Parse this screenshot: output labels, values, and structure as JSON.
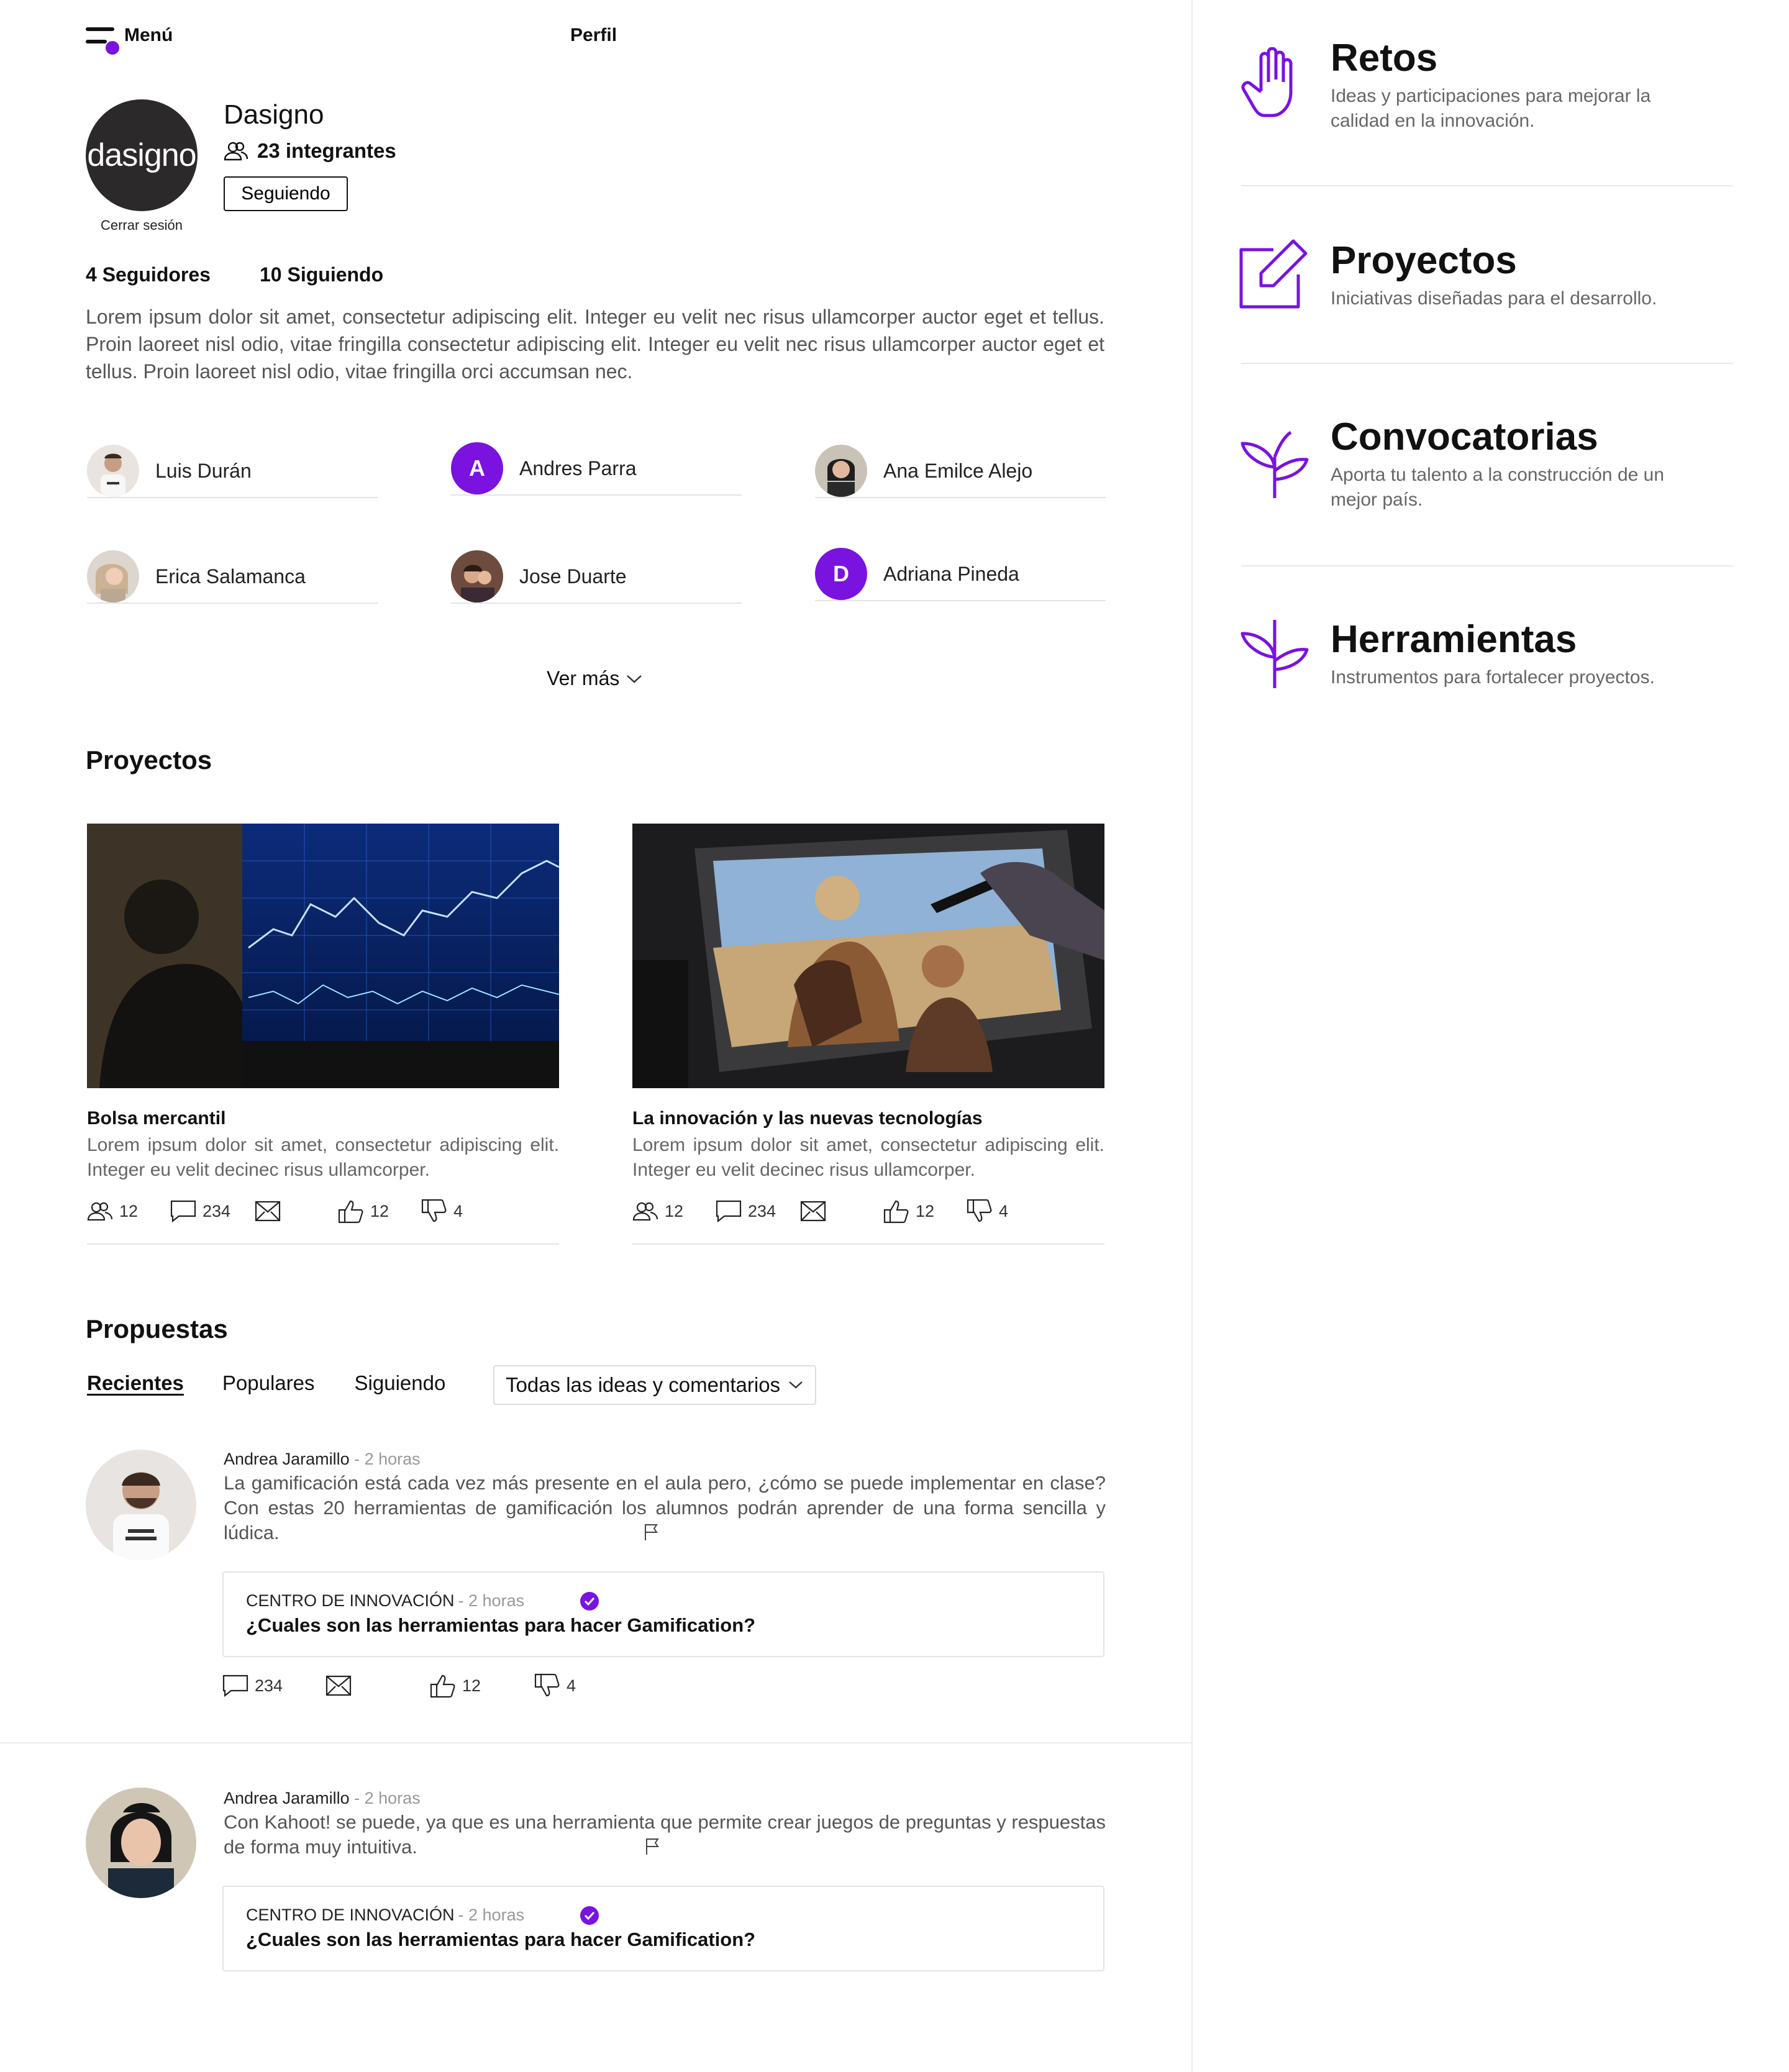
{
  "header": {
    "menu_label": "Menú",
    "page_title": "Perfil"
  },
  "profile": {
    "logo_text": "dasigno",
    "logout_label": "Cerrar sesión",
    "name": "Dasigno",
    "members_label": "23 integrantes",
    "follow_button": "Seguiendo",
    "followers": "4 Seguidores",
    "following": "10 Siguiendo",
    "description": "Lorem ipsum dolor sit amet, consectetur adipiscing elit. Integer eu velit nec risus ullamcorper auctor eget et tellus. Proin laoreet nisl odio, vitae fringilla consectetur adipiscing elit. Integer eu velit nec risus ullamcorper auctor eget et tellus. Proin laoreet nisl odio, vitae fringilla orci accumsan nec."
  },
  "members": [
    {
      "name": "Luis Durán",
      "avatar": "photo"
    },
    {
      "name": "Andres Parra",
      "avatar": "A"
    },
    {
      "name": "Ana Emilce Alejo",
      "avatar": "photo"
    },
    {
      "name": "Erica Salamanca",
      "avatar": "photo"
    },
    {
      "name": "Jose Duarte",
      "avatar": "photo"
    },
    {
      "name": "Adriana Pineda",
      "avatar": "D"
    }
  ],
  "ver_mas": "Ver más",
  "projects": {
    "heading": "Proyectos",
    "cards": [
      {
        "title": "Bolsa mercantil",
        "text": "Lorem ipsum dolor sit amet, consectetur adipiscing elit. Integer eu velit decinec risus ullamcorper.",
        "members": "12",
        "comments": "234",
        "likes": "12",
        "dislikes": "4"
      },
      {
        "title": "La innovación y las nuevas tecnologías",
        "text": "Lorem ipsum dolor sit amet, consectetur adipiscing elit. Integer eu velit decinec risus ullamcorper.",
        "members": "12",
        "comments": "234",
        "likes": "12",
        "dislikes": "4"
      }
    ]
  },
  "proposals": {
    "heading": "Propuestas",
    "tabs": [
      "Recientes",
      "Populares",
      "Siguiendo"
    ],
    "filter": "Todas las ideas y comentarios",
    "posts": [
      {
        "author": "Andrea Jaramillo",
        "time": " - 2 horas",
        "text": "La gamificación está cada vez más presente en el aula pero, ¿cómo se puede implementar en clase? Con estas 20 herramientas de gamificación los alumnos podrán aprender de una forma sencilla y lúdica.",
        "quote_author": "CENTRO DE INNOVACIÓN",
        "quote_time": " - 2 horas",
        "quote_title": "¿Cuales son las herramientas para hacer Gamification?",
        "comments": "234",
        "likes": "12",
        "dislikes": "4"
      },
      {
        "author": "Andrea Jaramillo",
        "time": " - 2 horas",
        "text": "Con Kahoot! se puede, ya que es una herramienta que permite crear juegos de preguntas y respuestas de forma muy intuitiva.",
        "quote_author": "CENTRO DE INNOVACIÓN",
        "quote_time": " - 2 horas",
        "quote_title": "¿Cuales son las herramientas para hacer Gamification?"
      }
    ]
  },
  "categories": [
    {
      "title": "Retos",
      "desc": "Ideas  y participaciones para mejorar la calidad en la innovación.",
      "icon": "hand-icon"
    },
    {
      "title": "Proyectos",
      "desc": "Iniciativas diseñadas para el desarrollo.",
      "icon": "edit-icon"
    },
    {
      "title": "Convocatorias",
      "desc": "Aporta tu talento a la construcción de un mejor país.",
      "icon": "sprout-icon"
    },
    {
      "title": "Herramientas",
      "desc": "Instrumentos para fortalecer proyectos.",
      "icon": "sprout-icon"
    }
  ],
  "colors": {
    "accent": "#7a12e0",
    "text": "#111111",
    "muted": "#666666",
    "divider": "#e6e6e6"
  }
}
